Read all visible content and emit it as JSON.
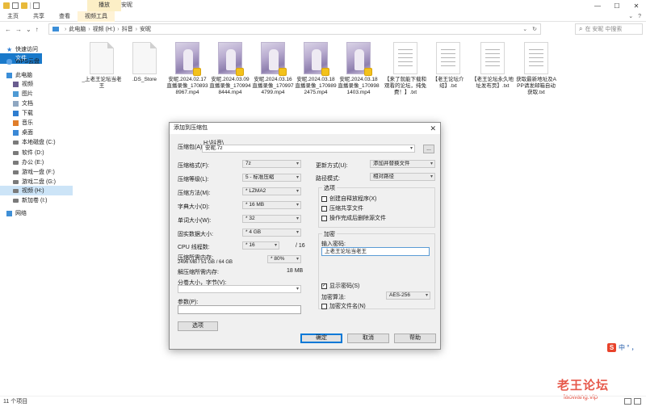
{
  "titlebar": {
    "context_tab": "播放",
    "title": "安昵",
    "minimize": "—",
    "maximize": "☐",
    "close": "✕"
  },
  "ribbon": {
    "tabs": [
      "文件",
      "主页",
      "共享",
      "查看",
      "视频工具"
    ],
    "active_index": 4
  },
  "address": {
    "segments": [
      "此电脑",
      "视频 (H:)",
      "抖音",
      "安昵"
    ],
    "search_placeholder": "在 安昵 中搜索"
  },
  "nav": {
    "items": [
      {
        "icon": "star",
        "label": "快速访问"
      },
      {
        "icon": "cloud",
        "label": "WPS云盘"
      },
      {
        "icon": "pc",
        "label": "此电脑"
      },
      {
        "icon": "vid",
        "label": "视频"
      },
      {
        "icon": "pic",
        "label": "图片"
      },
      {
        "icon": "doc",
        "label": "文档"
      },
      {
        "icon": "dl",
        "label": "下载"
      },
      {
        "icon": "music",
        "label": "音乐"
      },
      {
        "icon": "desk",
        "label": "桌面"
      },
      {
        "icon": "drv",
        "label": "本地磁盘 (C:)"
      },
      {
        "icon": "drv",
        "label": "软件 (D:)"
      },
      {
        "icon": "drv",
        "label": "办公 (E:)"
      },
      {
        "icon": "drv",
        "label": "游戏一盘 (F:)"
      },
      {
        "icon": "drv",
        "label": "游戏二盘 (G:)"
      },
      {
        "icon": "drv",
        "label": "视频 (H:)"
      },
      {
        "icon": "drv",
        "label": "新加卷 (I:)"
      },
      {
        "icon": "net",
        "label": "网络"
      }
    ],
    "selected_index": 14
  },
  "files": [
    {
      "kind": "doc",
      "name": "_上老王论坛当老王"
    },
    {
      "kind": "doc",
      "name": ".DS_Store"
    },
    {
      "kind": "vid",
      "name": "安昵.2024.02.17直播录像_1708938967.mp4"
    },
    {
      "kind": "vid",
      "name": "安昵.2024.03.09直播录像_1709948444.mp4"
    },
    {
      "kind": "vid",
      "name": "安昵.2024.03.16直播录像_1709974799.mp4"
    },
    {
      "kind": "vid",
      "name": "安昵.2024.03.18直播录像_1709892475.mp4"
    },
    {
      "kind": "vid",
      "name": "安昵.2024.03.18直播录像_1709981403.mp4"
    },
    {
      "kind": "txt",
      "name": "【来了就能下载和观看的论坛，纯免费！】.txt"
    },
    {
      "kind": "txt",
      "name": "【老王论坛介绍】.txt"
    },
    {
      "kind": "txt",
      "name": "【老王论坛永久地址发布页】.txt"
    },
    {
      "kind": "txt",
      "name": "获取最新地址及APP请发邮箱自动获取.txt"
    }
  ],
  "dialog": {
    "title": "添加到压缩包",
    "close": "✕",
    "archive_label": "压缩包(A):",
    "archive_path": "H:\\抖音\\",
    "archive_name": "安昵.7z",
    "browse": "...",
    "left": {
      "format_label": "压缩格式(F):",
      "format": "7z",
      "level_label": "压缩等级(L):",
      "level": "5 - 标准压缩",
      "method_label": "压缩方法(M):",
      "method": "* LZMA2",
      "dict_label": "字典大小(D):",
      "dict": "* 16 MB",
      "word_label": "单词大小(W):",
      "word": "* 32",
      "solid_label": "固实数据大小:",
      "solid": "* 4 GB",
      "cpu_label": "CPU 线程数:",
      "cpu": "* 16",
      "cpu_total": "/ 16",
      "mem_label": "压缩所需内存:",
      "mem_detail": "2496 MB / 51 GB / 64 GB",
      "mem_pct": "* 80%",
      "decomp_label": "解压缩所需内存:",
      "decomp_val": "18 MB",
      "split_label": "分卷大小，字节(V):",
      "params_label": "参数(P):",
      "options_btn": "选项"
    },
    "right": {
      "update_label": "更新方式(U):",
      "update": "添加并替换文件",
      "path_label": "路径模式:",
      "path": "相对路径",
      "options_title": "选项",
      "opt1": "创建自释放程序(X)",
      "opt2": "压缩共享文件",
      "opt3": "操作完成后删除源文件",
      "enc_title": "加密",
      "pwd_label": "输入密码:",
      "pwd_value": "上老王论坛当老王",
      "show_pwd": "显示密码(S)",
      "enc_method_label": "加密算法:",
      "enc_method": "AES-256",
      "enc_names": "加密文件名(N)"
    },
    "ok": "确定",
    "cancel": "取消",
    "help": "帮助"
  },
  "statusbar": {
    "count": "11 个项目"
  },
  "ime": {
    "s": "S",
    "text": "中 ° ，"
  },
  "watermark": {
    "line1": "老王论坛",
    "line2": "laowang.vip"
  }
}
